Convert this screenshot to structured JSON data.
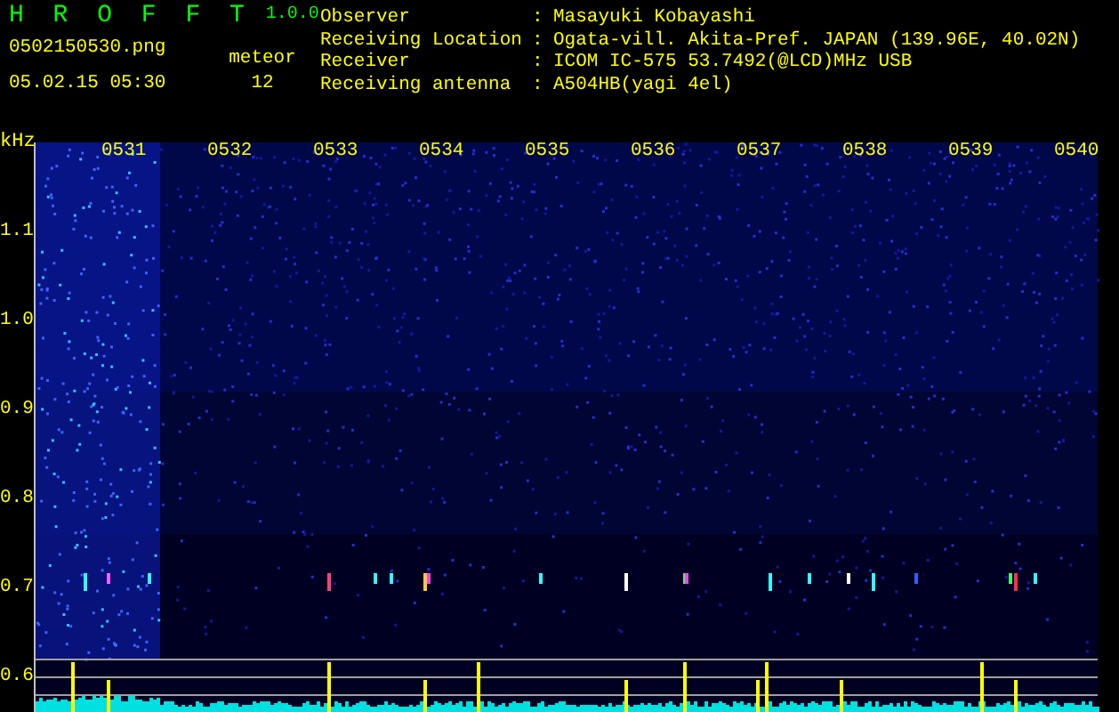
{
  "app": {
    "title": "H R O F F T",
    "version": "1.0.0"
  },
  "file_name": "0502150530.png",
  "timestamp": "05.02.15 05:30",
  "meteor": {
    "label": "meteor",
    "count": "12"
  },
  "info": [
    {
      "label": "Observer",
      "separator": ":",
      "value": "Masayuki Kobayashi"
    },
    {
      "label": "Receiving Location",
      "separator": ":",
      "value": "Ogata-vill. Akita-Pref. JAPAN (139.96E, 40.02N)"
    },
    {
      "label": "Receiver",
      "separator": ":",
      "value": "ICOM IC-575 53.7492(@LCD)MHz USB"
    },
    {
      "label": "Receiving antenna",
      "separator": ":",
      "value": "A504HB(yagi 4el)"
    }
  ],
  "spectrogram": {
    "y_unit": "kHz",
    "y_labels": [
      "1.1",
      "1.0",
      "0.9",
      "0.8",
      "0.7",
      "0.6"
    ],
    "x_labels": [
      "0531",
      "0532",
      "0533",
      "0534",
      "0535",
      "0536",
      "0537",
      "0538",
      "0539",
      "0540"
    ]
  }
}
